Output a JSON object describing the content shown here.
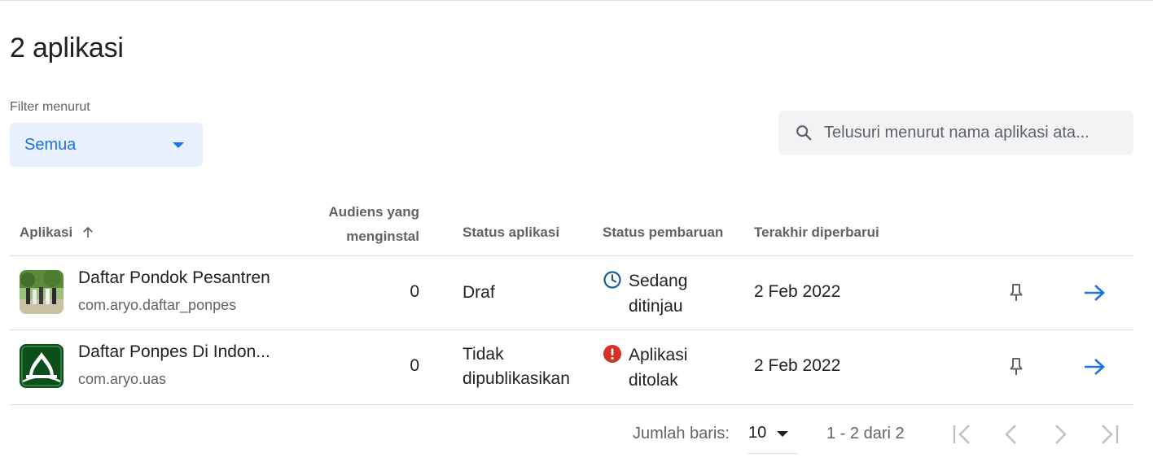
{
  "header": {
    "title": "2 aplikasi"
  },
  "filter": {
    "label": "Filter menurut",
    "selected": "Semua"
  },
  "search": {
    "placeholder": "Telusuri menurut nama aplikasi ata..."
  },
  "table": {
    "columns": {
      "app": "Aplikasi",
      "audience": "Audiens yang menginstal",
      "app_status": "Status aplikasi",
      "update_status": "Status pembaruan",
      "last_updated": "Terakhir diperbarui"
    },
    "rows": [
      {
        "name": "Daftar Pondok Pesantren",
        "package": "com.aryo.daftar_ponpes",
        "audience": "0",
        "app_status": "Draf",
        "update_status": "Sedang ditinjau",
        "update_icon": "clock-icon",
        "last_updated": "2 Feb 2022"
      },
      {
        "name": "Daftar Ponpes Di Indon...",
        "package": "com.aryo.uas",
        "audience": "0",
        "app_status": "Tidak dipublikasikan",
        "update_status": "Aplikasi ditolak",
        "update_icon": "error-icon",
        "last_updated": "2 Feb 2022"
      }
    ]
  },
  "pagination": {
    "rows_label": "Jumlah baris:",
    "rows_per_page": "10",
    "range": "1 - 2 dari 2"
  },
  "colors": {
    "accent": "#1a73e8",
    "clock": "#1a5a9a",
    "error": "#d93025",
    "text_secondary": "#5f6368"
  }
}
